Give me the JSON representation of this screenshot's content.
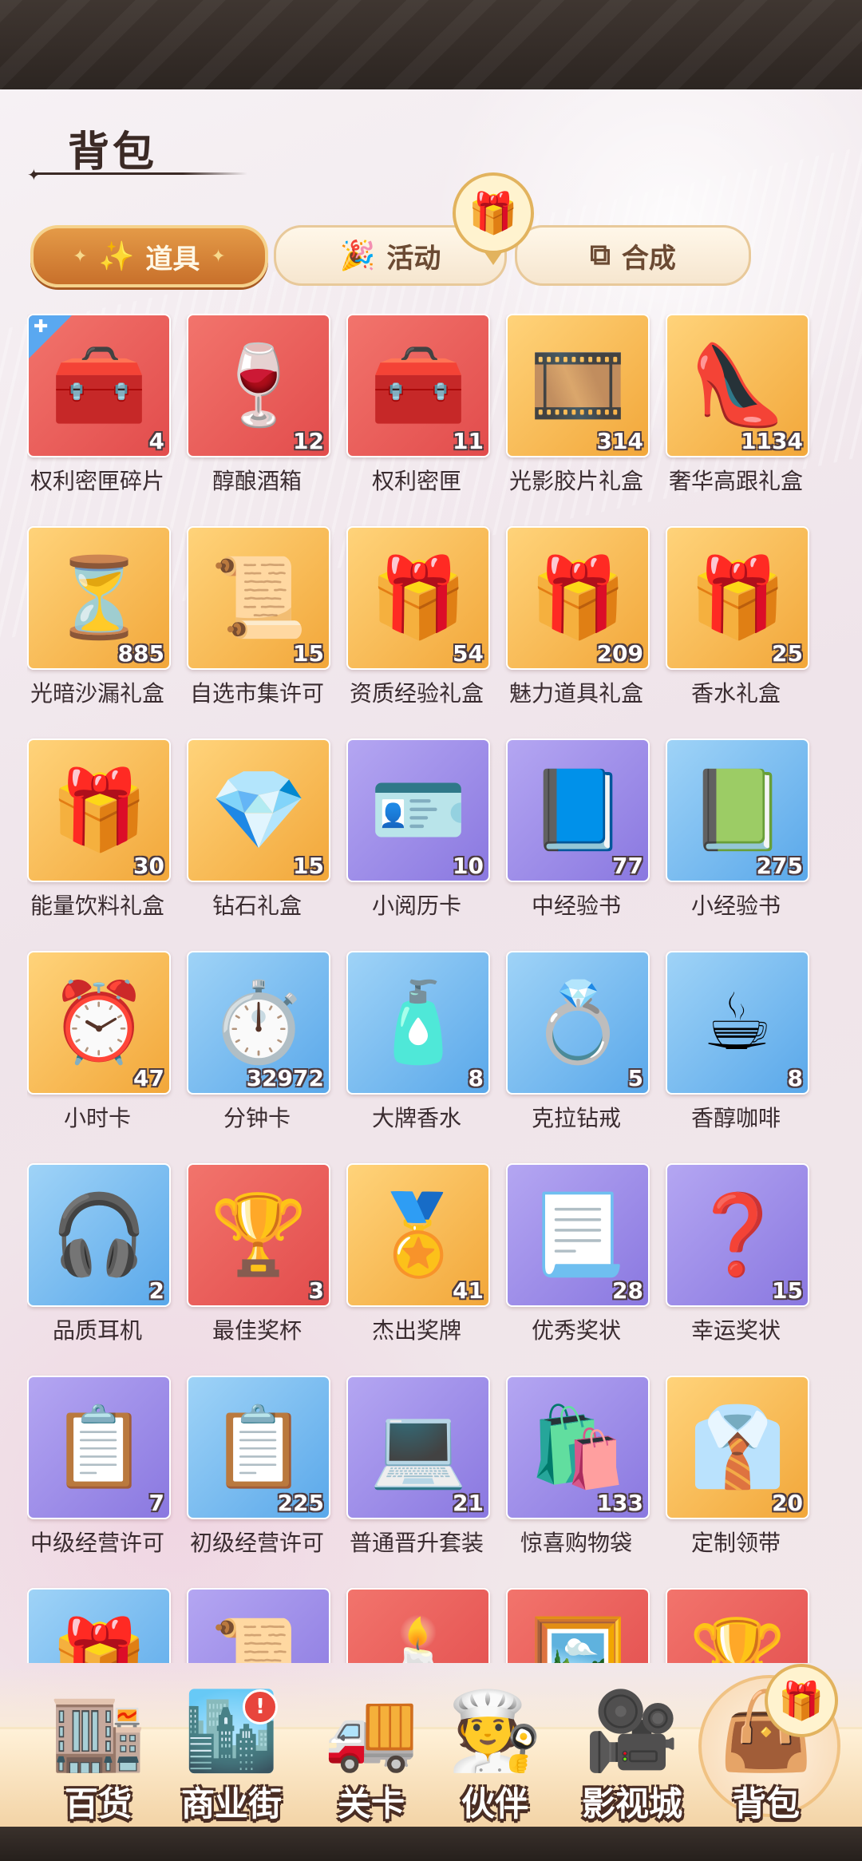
{
  "page": {
    "title": "背包"
  },
  "tabs": [
    {
      "label": "道具",
      "icon": "✨",
      "icon_name": "sparkle-wand-icon"
    },
    {
      "label": "活动",
      "icon": "🎉",
      "icon_name": "party-popper-icon"
    },
    {
      "label": "合成",
      "icon": "⧉",
      "icon_name": "combine-squares-icon"
    }
  ],
  "items": [
    {
      "name": "权利密匣碎片",
      "qty": "4",
      "icon": "🧰",
      "bg": "red",
      "fragment": true
    },
    {
      "name": "醇酿酒箱",
      "qty": "12",
      "icon": "🍷",
      "bg": "red"
    },
    {
      "name": "权利密匣",
      "qty": "11",
      "icon": "🧰",
      "bg": "red"
    },
    {
      "name": "光影胶片礼盒",
      "qty": "314",
      "icon": "🎞️",
      "bg": "orange"
    },
    {
      "name": "奢华高跟礼盒",
      "qty": "1134",
      "icon": "👠",
      "bg": "orange"
    },
    {
      "name": "光暗沙漏礼盒",
      "qty": "885",
      "icon": "⏳",
      "bg": "orange"
    },
    {
      "name": "自选市集许可",
      "qty": "15",
      "icon": "📜",
      "bg": "orange"
    },
    {
      "name": "资质经验礼盒",
      "qty": "54",
      "icon": "🎁",
      "bg": "orange"
    },
    {
      "name": "魅力道具礼盒",
      "qty": "209",
      "icon": "🎁",
      "bg": "orange"
    },
    {
      "name": "香水礼盒",
      "qty": "25",
      "icon": "🎁",
      "bg": "orange"
    },
    {
      "name": "能量饮料礼盒",
      "qty": "30",
      "icon": "🎁",
      "bg": "orange"
    },
    {
      "name": "钻石礼盒",
      "qty": "15",
      "icon": "💎",
      "bg": "orange"
    },
    {
      "name": "小阅历卡",
      "qty": "10",
      "icon": "🪪",
      "bg": "purple"
    },
    {
      "name": "中经验书",
      "qty": "77",
      "icon": "📘",
      "bg": "purple"
    },
    {
      "name": "小经验书",
      "qty": "275",
      "icon": "📗",
      "bg": "blue"
    },
    {
      "name": "小时卡",
      "qty": "47",
      "icon": "⏰",
      "bg": "orange"
    },
    {
      "name": "分钟卡",
      "qty": "32972",
      "icon": "⏱️",
      "bg": "blue"
    },
    {
      "name": "大牌香水",
      "qty": "8",
      "icon": "🧴",
      "bg": "blue"
    },
    {
      "name": "克拉钻戒",
      "qty": "5",
      "icon": "💍",
      "bg": "blue"
    },
    {
      "name": "香醇咖啡",
      "qty": "8",
      "icon": "☕",
      "bg": "blue"
    },
    {
      "name": "品质耳机",
      "qty": "2",
      "icon": "🎧",
      "bg": "blue"
    },
    {
      "name": "最佳奖杯",
      "qty": "3",
      "icon": "🏆",
      "bg": "red"
    },
    {
      "name": "杰出奖牌",
      "qty": "41",
      "icon": "🏅",
      "bg": "orange"
    },
    {
      "name": "优秀奖状",
      "qty": "28",
      "icon": "📃",
      "bg": "purple"
    },
    {
      "name": "幸运奖状",
      "qty": "15",
      "icon": "❓",
      "bg": "purple"
    },
    {
      "name": "中级经营许可",
      "qty": "7",
      "icon": "📋",
      "bg": "purple"
    },
    {
      "name": "初级经营许可",
      "qty": "225",
      "icon": "📋",
      "bg": "blue"
    },
    {
      "name": "普通晋升套装",
      "qty": "21",
      "icon": "💻",
      "bg": "purple"
    },
    {
      "name": "惊喜购物袋",
      "qty": "133",
      "icon": "🛍️",
      "bg": "purple"
    },
    {
      "name": "定制领带",
      "qty": "20",
      "icon": "👔",
      "bg": "orange"
    },
    {
      "name": "",
      "qty": "",
      "icon": "🎁",
      "bg": "blue"
    },
    {
      "name": "",
      "qty": "",
      "icon": "📜",
      "bg": "purple"
    },
    {
      "name": "",
      "qty": "",
      "icon": "🕯️",
      "bg": "red"
    },
    {
      "name": "",
      "qty": "",
      "icon": "🖼️",
      "bg": "red"
    },
    {
      "name": "",
      "qty": "",
      "icon": "🏆",
      "bg": "red"
    }
  ],
  "nav": [
    {
      "label": "百货",
      "icon": "🏬",
      "name": "nav-department-store"
    },
    {
      "label": "商业街",
      "icon": "🏙️",
      "name": "nav-business-street",
      "badge": "!"
    },
    {
      "label": "关卡",
      "icon": "🚚",
      "name": "nav-levels"
    },
    {
      "label": "伙伴",
      "icon": "🧑‍🍳",
      "name": "nav-partners"
    },
    {
      "label": "影视城",
      "icon": "🎥",
      "name": "nav-film-city"
    },
    {
      "label": "背包",
      "icon": "👜",
      "name": "nav-backpack",
      "active": true
    }
  ],
  "gift_badge_icon": "🎁",
  "colors": {
    "active_tab": "#d98236",
    "text_dark": "#3b2a25"
  }
}
